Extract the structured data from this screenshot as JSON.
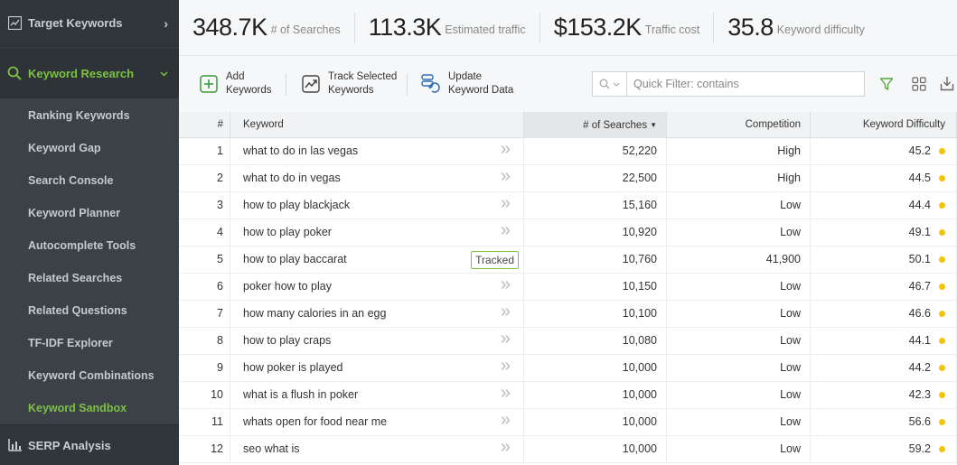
{
  "sidebar": {
    "target_keywords": "Target Keywords",
    "keyword_research": "Keyword Research",
    "items": [
      {
        "label": "Ranking Keywords",
        "active": false
      },
      {
        "label": "Keyword Gap",
        "active": false
      },
      {
        "label": "Search Console",
        "active": false
      },
      {
        "label": "Keyword Planner",
        "active": false
      },
      {
        "label": "Autocomplete Tools",
        "active": false
      },
      {
        "label": "Related Searches",
        "active": false
      },
      {
        "label": "Related Questions",
        "active": false
      },
      {
        "label": "TF-IDF Explorer",
        "active": false
      },
      {
        "label": "Keyword Combinations",
        "active": false
      },
      {
        "label": "Keyword Sandbox",
        "active": true
      }
    ],
    "serp_analysis": "SERP Analysis"
  },
  "stats": [
    {
      "value": "348.7K",
      "label": "# of Searches"
    },
    {
      "value": "113.3K",
      "label": "Estimated traffic"
    },
    {
      "value": "$153.2K",
      "label": "Traffic cost"
    },
    {
      "value": "35.8",
      "label": "Keyword difficulty"
    }
  ],
  "toolbar": {
    "add_line1": "Add",
    "add_line2": "Keywords",
    "track_line1": "Track Selected",
    "track_line2": "Keywords",
    "update_line1": "Update",
    "update_line2": "Keyword Data",
    "filter_placeholder": "Quick Filter: contains"
  },
  "table": {
    "headers": {
      "num": "#",
      "keyword": "Keyword",
      "searches": "# of Searches",
      "competition": "Competition",
      "difficulty": "Keyword Difficulty"
    },
    "tracked_label": "Tracked",
    "difficulty_dot_color": "#f2c500",
    "accent_color": "#7dc142",
    "rows": [
      {
        "num": "1",
        "keyword": "what to do in las vegas",
        "searches": "52,220",
        "competition": "High",
        "difficulty": "45.2",
        "tracked": false
      },
      {
        "num": "2",
        "keyword": "what to do in vegas",
        "searches": "22,500",
        "competition": "High",
        "difficulty": "44.5",
        "tracked": false
      },
      {
        "num": "3",
        "keyword": "how to play blackjack",
        "searches": "15,160",
        "competition": "Low",
        "difficulty": "44.4",
        "tracked": false
      },
      {
        "num": "4",
        "keyword": "how to play poker",
        "searches": "10,920",
        "competition": "Low",
        "difficulty": "49.1",
        "tracked": false
      },
      {
        "num": "5",
        "keyword": "how to play baccarat",
        "searches": "10,760",
        "competition": "41,900",
        "difficulty": "50.1",
        "tracked": true
      },
      {
        "num": "6",
        "keyword": "poker how to play",
        "searches": "10,150",
        "competition": "Low",
        "difficulty": "46.7",
        "tracked": false
      },
      {
        "num": "7",
        "keyword": "how many calories in an egg",
        "searches": "10,100",
        "competition": "Low",
        "difficulty": "46.6",
        "tracked": false
      },
      {
        "num": "8",
        "keyword": "how to play craps",
        "searches": "10,080",
        "competition": "Low",
        "difficulty": "44.1",
        "tracked": false
      },
      {
        "num": "9",
        "keyword": "how poker is played",
        "searches": "10,000",
        "competition": "Low",
        "difficulty": "44.2",
        "tracked": false
      },
      {
        "num": "10",
        "keyword": "what is a flush in poker",
        "searches": "10,000",
        "competition": "Low",
        "difficulty": "42.3",
        "tracked": false
      },
      {
        "num": "11",
        "keyword": "whats open for food near me",
        "searches": "10,000",
        "competition": "Low",
        "difficulty": "56.6",
        "tracked": false
      },
      {
        "num": "12",
        "keyword": "seo what is",
        "searches": "10,000",
        "competition": "Low",
        "difficulty": "59.2",
        "tracked": false
      }
    ]
  }
}
